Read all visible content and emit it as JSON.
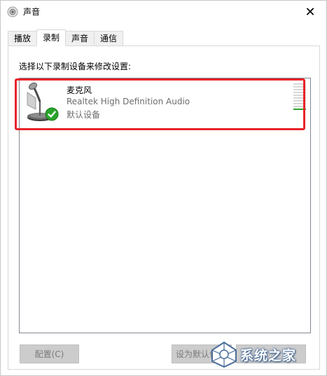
{
  "window": {
    "title": "声音"
  },
  "tabs": [
    {
      "label": "播放"
    },
    {
      "label": "录制",
      "active": true
    },
    {
      "label": "声音"
    },
    {
      "label": "通信"
    }
  ],
  "panel": {
    "instruction": "选择以下录制设备来修改设置:"
  },
  "devices": [
    {
      "name": "麦克风",
      "driver": "Realtek High Definition Audio",
      "status": "默认设备",
      "icon": "microphone-icon",
      "default_badge": "green-check-icon"
    }
  ],
  "buttons": {
    "configure": "配置(C)",
    "set_default": "设为默认值",
    "properties": ""
  },
  "watermark": {
    "text": "系统之家"
  },
  "colors": {
    "highlight": "#e8232a",
    "check_green": "#2aa32a",
    "level_meter_idle": "#d7d7d7"
  }
}
